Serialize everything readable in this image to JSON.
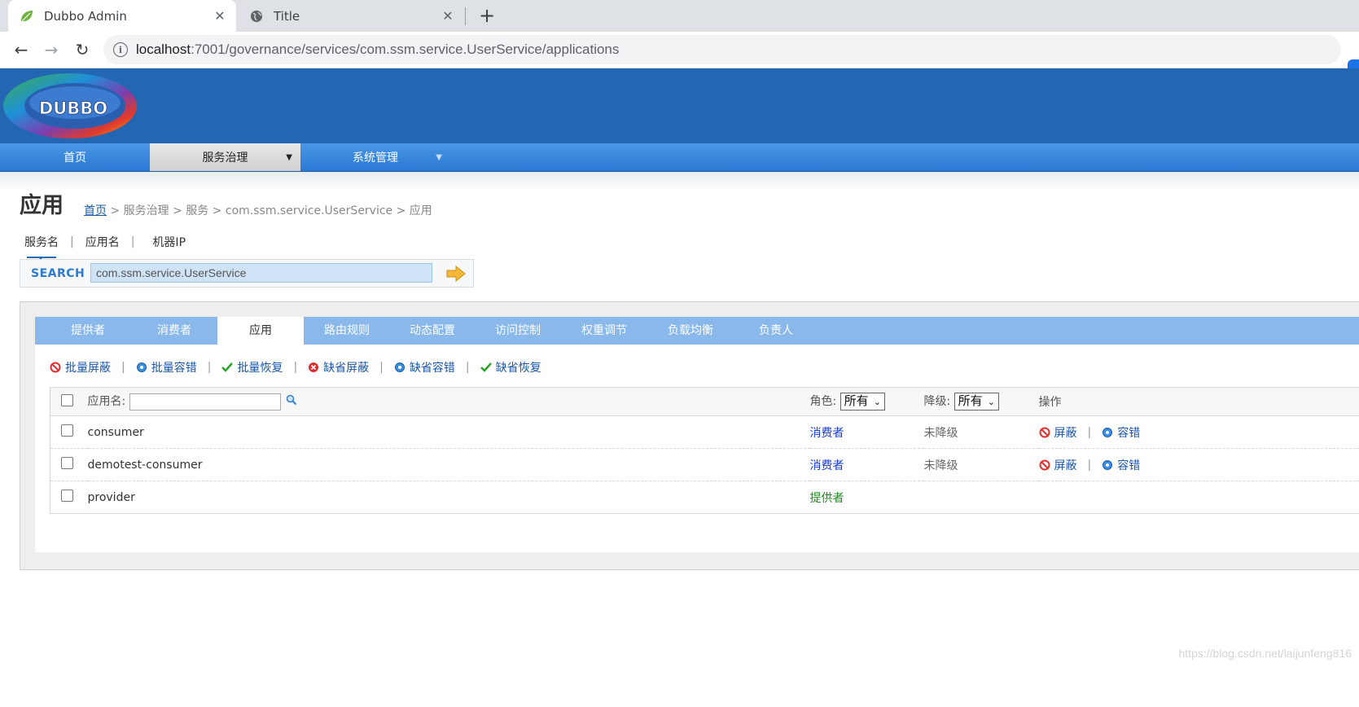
{
  "browser": {
    "tabs": [
      {
        "title": "Dubbo Admin",
        "close": "✕"
      },
      {
        "title": "Title",
        "close": "✕"
      }
    ],
    "new_tab": "+",
    "url_host": "localhost",
    "url_path": ":7001/governance/services/com.ssm.service.UserService/applications",
    "back": "←",
    "forward": "→",
    "reload": "↻"
  },
  "nav": {
    "home": "首页",
    "governance": "服务治理",
    "system": "系统管理",
    "caret": "▼"
  },
  "page": {
    "title": "应用",
    "breadcrumb": {
      "home": "首页",
      "rest": " > 服务治理 > 服务 > com.ssm.service.UserService > 应用"
    }
  },
  "search": {
    "types": [
      "服务名",
      "应用名",
      "机器IP"
    ],
    "sep": "|",
    "label": "SEARCH",
    "value": "com.ssm.service.UserService"
  },
  "content_tabs": [
    "提供者",
    "消费者",
    "应用",
    "路由规则",
    "动态配置",
    "访问控制",
    "权重调节",
    "负载均衡",
    "负责人"
  ],
  "actions": [
    "批量屏蔽",
    "批量容错",
    "批量恢复",
    "缺省屏蔽",
    "缺省容错",
    "缺省恢复"
  ],
  "table": {
    "app_label": "应用名:",
    "role_label": "角色:",
    "role_value": "所有",
    "grade_label": "降级:",
    "grade_value": "所有",
    "op_label": "操作",
    "rows": [
      {
        "name": "consumer",
        "role": "消费者",
        "grade": "未降级",
        "op1": "屏蔽",
        "op2": "容错"
      },
      {
        "name": "demotest-consumer",
        "role": "消费者",
        "grade": "未降级",
        "op1": "屏蔽",
        "op2": "容错"
      },
      {
        "name": "provider",
        "role": "提供者",
        "grade": "",
        "op1": "",
        "op2": ""
      }
    ]
  },
  "watermark": "https://blog.csdn.net/laijunfeng816",
  "colors": {
    "header": "#2367b3",
    "menubar": "#2a78d2",
    "content_tabs": "#8ab8ea",
    "consumer": "#1a3fd0",
    "provider": "#1e8a1e"
  }
}
